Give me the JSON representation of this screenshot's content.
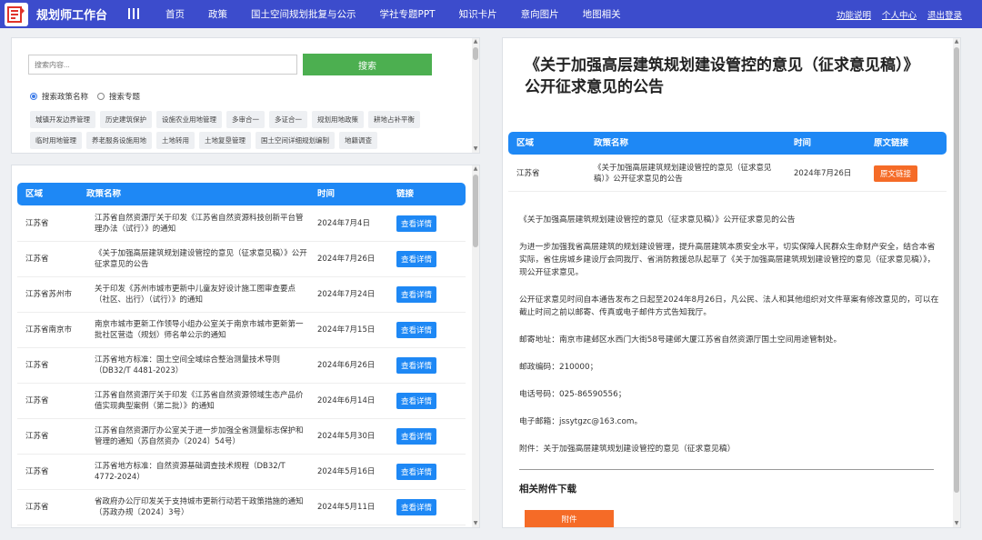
{
  "app": {
    "title": "规划师工作台",
    "nav": [
      "首页",
      "政策",
      "国土空间规划批复与公示",
      "学社专题PPT",
      "知识卡片",
      "意向图片",
      "地图相关"
    ],
    "right_links": [
      "功能说明",
      "个人中心",
      "退出登录"
    ],
    "accent": "#3c4ccc"
  },
  "search": {
    "placeholder": "搜索内容...",
    "button": "搜索",
    "radio_options": [
      "搜索政策名称",
      "搜索专题"
    ],
    "tags": [
      "城镇开发边界管理",
      "历史建筑保护",
      "设施农业用地管理",
      "多审合一",
      "多证合一",
      "规划用地政策",
      "耕地占补平衡",
      "临时用地管理",
      "养老服务设施用地",
      "土地转用",
      "土地复垦管理",
      "国土空间详细规划编制",
      "地籍调查"
    ]
  },
  "list": {
    "headers": [
      "区域",
      "政策名称",
      "时间",
      "链接"
    ],
    "detail_label": "查看详情",
    "rows": [
      {
        "region": "江苏省",
        "name": "江苏省自然资源厅关于印发《江苏省自然资源科技创新平台管理办法（试行）》的通知",
        "date": "2024年7月4日"
      },
      {
        "region": "江苏省",
        "name": "《关于加强高层建筑规划建设管控的意见（征求意见稿）》公开征求意见的公告",
        "date": "2024年7月26日"
      },
      {
        "region": "江苏省苏州市",
        "name": "关于印发《苏州市城市更新中儿童友好设计施工图审查要点（社区、出行）（试行）》的通知",
        "date": "2024年7月24日"
      },
      {
        "region": "江苏省南京市",
        "name": "南京市城市更新工作领导小组办公室关于南京市城市更新第一批社区营造（规划）师名单公示的通知",
        "date": "2024年7月15日"
      },
      {
        "region": "江苏省",
        "name": "江苏省地方标准：国土空间全域综合整治测量技术导则（DB32/T 4481-2023）",
        "date": "2024年6月26日"
      },
      {
        "region": "江苏省",
        "name": "江苏省自然资源厅关于印发《江苏省自然资源领域生态产品价值实现典型案例（第二批）》的通知",
        "date": "2024年6月14日"
      },
      {
        "region": "江苏省",
        "name": "江苏省自然资源厅办公室关于进一步加强全省测量标志保护和管理的通知（苏自然资办〔2024〕54号）",
        "date": "2024年5月30日"
      },
      {
        "region": "江苏省",
        "name": "江苏省地方标准：自然资源基础调查技术规程（DB32/T 4772-2024）",
        "date": "2024年5月16日"
      },
      {
        "region": "江苏省",
        "name": "省政府办公厅印发关于支持城市更新行动若干政策措施的通知（苏政办规〔2024〕3号）",
        "date": "2024年5月11日"
      }
    ]
  },
  "detail": {
    "title": "《关于加强高层建筑规划建设管控的意见（征求意见稿）》公开征求意见的公告",
    "headers": [
      "区域",
      "政策名称",
      "时间",
      "原文链接"
    ],
    "row": {
      "region": "江苏省",
      "name": "《关于加强高层建筑规划建设管控的意见（征求意见稿）》公开征求意见的公告",
      "date": "2024年7月26日",
      "link_label": "原文链接"
    },
    "paragraphs": [
      "《关于加强高层建筑规划建设管控的意见（征求意见稿）》公开征求意见的公告",
      "为进一步加强我省高层建筑的规划建设管理，提升高层建筑本质安全水平，切实保障人民群众生命财产安全，结合本省实际，省住房城乡建设厅会同我厅、省消防救援总队起草了《关于加强高层建筑规划建设管控的意见（征求意见稿）》，现公开征求意见。",
      "公开征求意见时间自本通告发布之日起至2024年8月26日，凡公民、法人和其他组织对文件草案有修改意见的，可以在截止时间之前以邮寄、传真或电子邮件方式告知我厅。",
      "邮寄地址：南京市建邺区水西门大街58号建邺大厦江苏省自然资源厅国土空间用途管制处。",
      "邮政编码：210000；",
      "电话号码：025-86590556；",
      "电子邮箱：jssytgzc@163.com。",
      "附件：关于加强高层建筑规划建设管控的意见（征求意见稿）"
    ],
    "attach_title": "相关附件下载",
    "attach_button": "附件"
  }
}
